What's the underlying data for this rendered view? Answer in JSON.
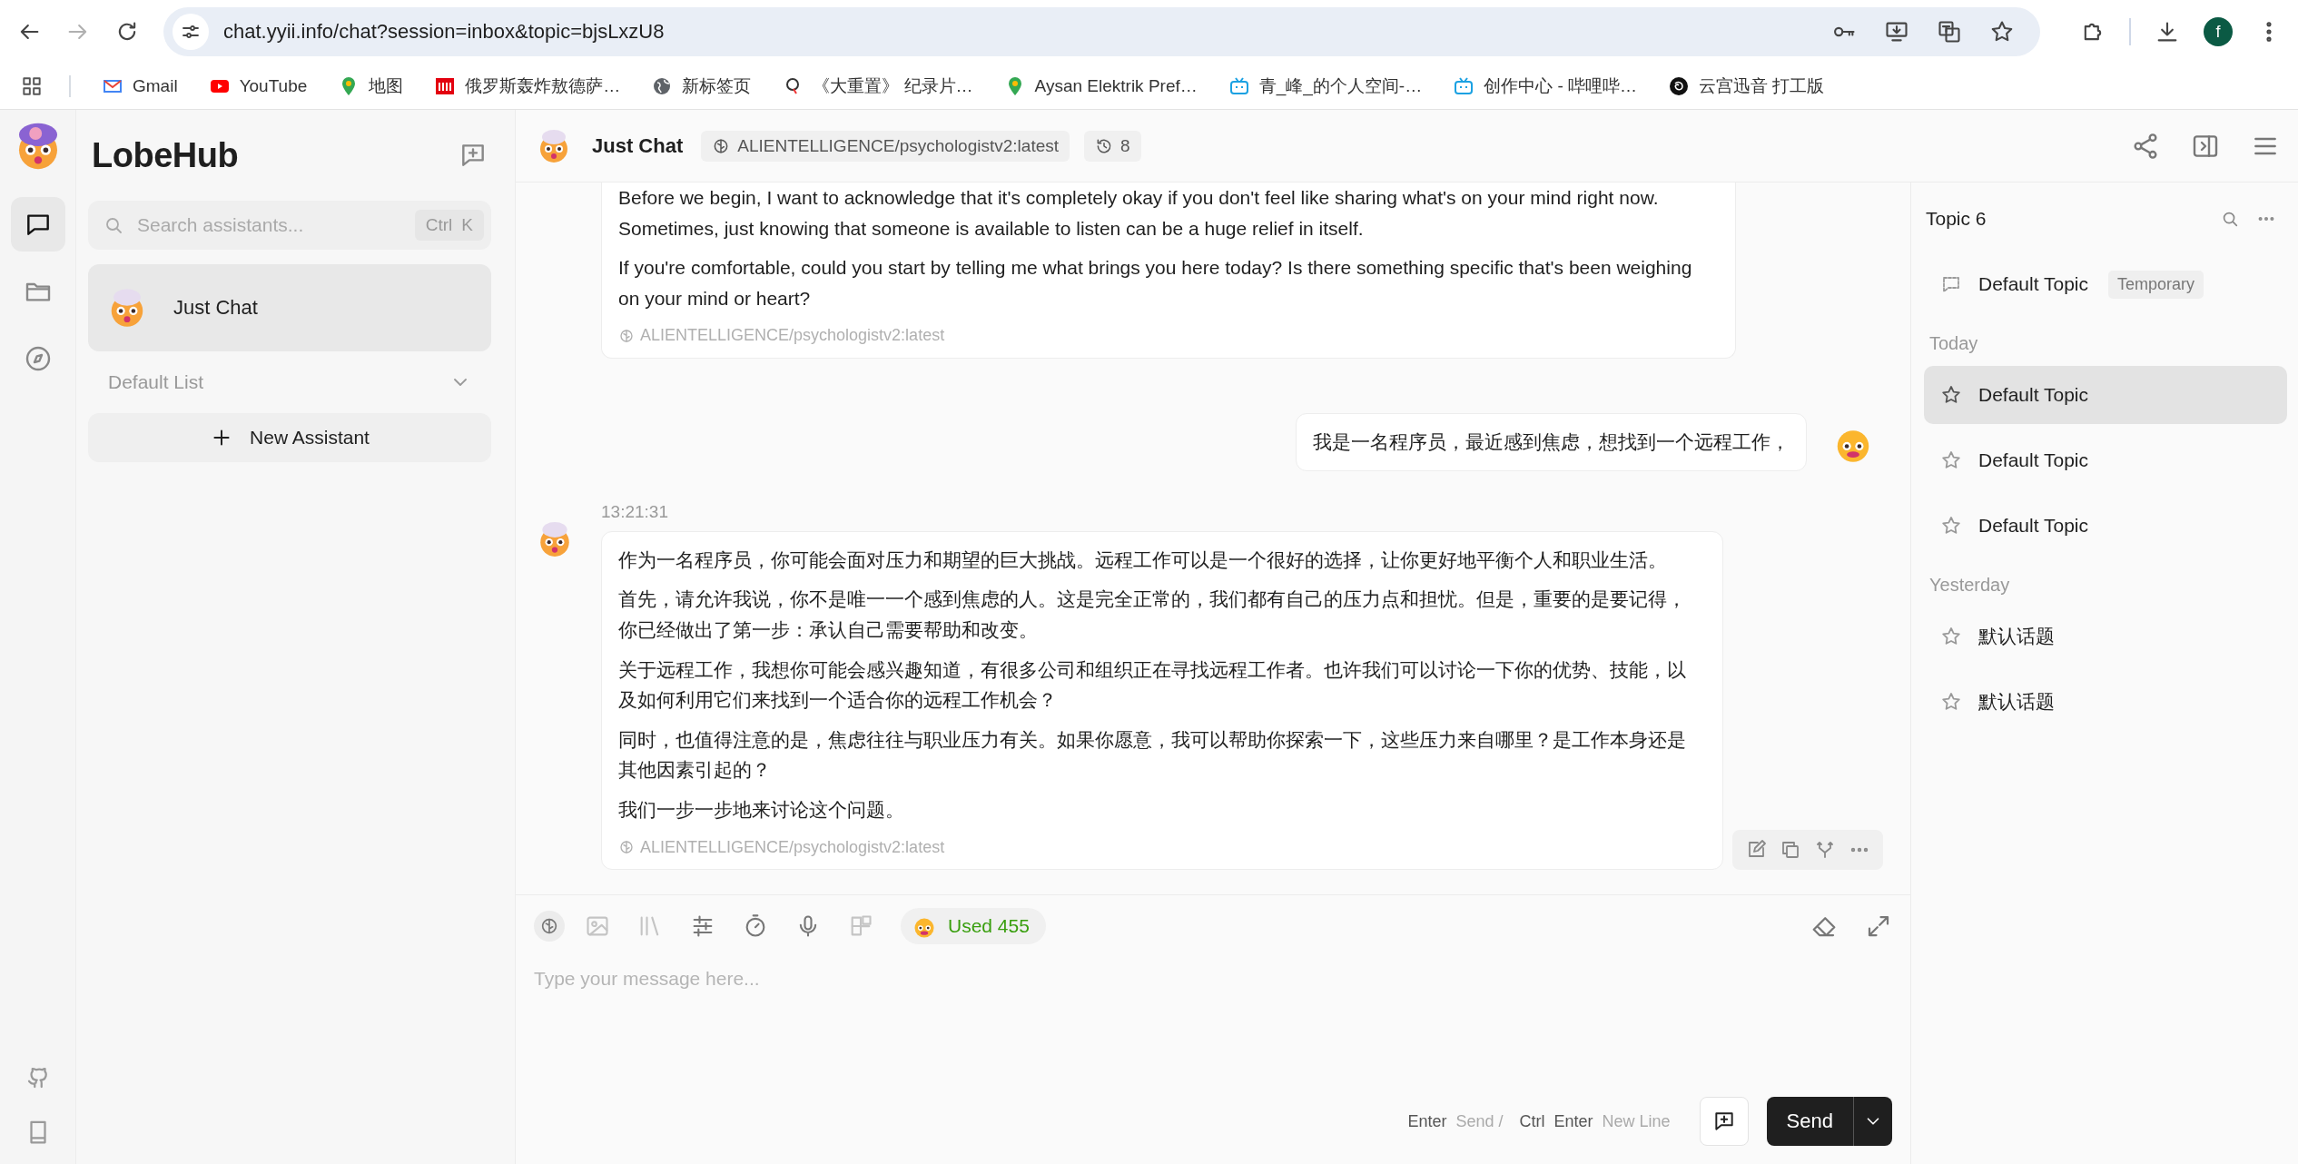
{
  "browser": {
    "url": "chat.yyii.info/chat?session=inbox&topic=bjsLxzU8",
    "profile_initial": "f",
    "bookmarks": [
      {
        "kind": "mail",
        "label": "Gmail"
      },
      {
        "kind": "video",
        "label": "YouTube"
      },
      {
        "kind": "pin",
        "label": "地图"
      },
      {
        "kind": "news",
        "label": "俄罗斯轰炸敖德萨…"
      },
      {
        "kind": "globe",
        "label": "新标签页"
      },
      {
        "kind": "q",
        "label": "《大重置》 纪录片…"
      },
      {
        "kind": "pin",
        "label": "Aysan Elektrik Pref…"
      },
      {
        "kind": "tv",
        "label": "青_峰_的个人空间-…"
      },
      {
        "kind": "tv",
        "label": "创作中心 - 哔哩哔…"
      },
      {
        "kind": "spiral",
        "label": "云宫迅音 打工版"
      }
    ]
  },
  "rail": [
    {
      "kind": "chat",
      "selected": true
    },
    {
      "kind": "files",
      "selected": false
    },
    {
      "kind": "discover",
      "selected": false
    }
  ],
  "sidebar": {
    "brand": "LobeHub",
    "search": {
      "placeholder": "Search assistants...",
      "keys": [
        "Ctrl",
        "K"
      ]
    },
    "sessions": [
      {
        "name": "Just Chat",
        "selected": true
      }
    ],
    "group": "Default List",
    "new_button": "New Assistant"
  },
  "chat": {
    "title": "Just Chat",
    "model": "ALIENTELLIGENCE/psychologistv2:latest",
    "history_count": "8",
    "messages": [
      {
        "kind": "assistant",
        "paragraphs": [
          "Before we begin, I want to acknowledge that it's completely okay if you don't feel like sharing what's on your mind right now. Sometimes, just knowing that someone is available to listen can be a huge relief in itself.",
          "If you're comfortable, could you start by telling me what brings you here today? Is there something specific that's been weighing on your mind or heart?"
        ],
        "model": "ALIENTELLIGENCE/psychologistv2:latest"
      },
      {
        "kind": "user",
        "paragraphs": [
          "我是一名程序员，最近感到焦虑，想找到一个远程工作，"
        ]
      },
      {
        "kind": "assistant",
        "time": "13:21:31",
        "paragraphs": [
          "作为一名程序员，你可能会面对压力和期望的巨大挑战。远程工作可以是一个很好的选择，让你更好地平衡个人和职业生活。",
          "首先，请允许我说，你不是唯一一个感到焦虑的人。这是完全正常的，我们都有自己的压力点和担忧。但是，重要的是要记得，你已经做出了第一步：承认自己需要帮助和改变。",
          "关于远程工作，我想你可能会感兴趣知道，有很多公司和组织正在寻找远程工作者。也许我们可以讨论一下你的优势、技能，以及如何利用它们来找到一个适合你的远程工作机会？",
          "同时，也值得注意的是，焦虑往往与职业压力有关。如果你愿意，我可以帮助你探索一下，这些压力来自哪里？是工作本身还是其他因素引起的？",
          "我们一步一步地来讨论这个问题。"
        ],
        "model": "ALIENTELLIGENCE/psychologistv2:latest",
        "actions": true
      }
    ]
  },
  "input": {
    "tools": [
      {
        "kind": "brain",
        "disabled": false
      },
      {
        "kind": "image",
        "disabled": true
      },
      {
        "kind": "library",
        "disabled": true
      },
      {
        "kind": "sliders",
        "disabled": false
      },
      {
        "kind": "timer",
        "disabled": false
      },
      {
        "kind": "mic",
        "disabled": false
      },
      {
        "kind": "blocks",
        "disabled": true
      }
    ],
    "usage": "Used 455",
    "placeholder": "Type your message here...",
    "hints": [
      {
        "keys": [
          "Enter"
        ],
        "label": "Send /"
      },
      {
        "keys": [
          "Ctrl",
          "Enter"
        ],
        "label": "New Line"
      }
    ],
    "send": "Send"
  },
  "topics": {
    "title": "Topic 6",
    "default": {
      "label": "Default Topic",
      "tag": "Temporary"
    },
    "groups": [
      {
        "label": "Today",
        "items": [
          {
            "label": "Default Topic",
            "selected": true
          },
          {
            "label": "Default Topic",
            "selected": false
          },
          {
            "label": "Default Topic",
            "selected": false
          }
        ]
      },
      {
        "label": "Yesterday",
        "items": [
          {
            "label": "默认话题",
            "selected": false
          },
          {
            "label": "默认话题",
            "selected": false
          }
        ]
      }
    ]
  }
}
